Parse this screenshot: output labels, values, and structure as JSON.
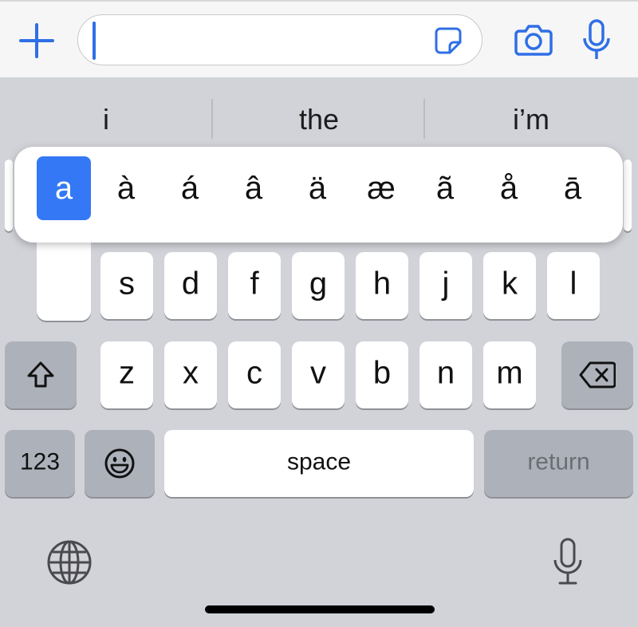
{
  "top_bar": {
    "input_value": "",
    "icons": [
      "plus-icon",
      "sticker-icon",
      "camera-icon",
      "microphone-icon"
    ]
  },
  "suggestions": [
    "i",
    "the",
    "i’m"
  ],
  "accent_popup": [
    "a",
    "à",
    "á",
    "â",
    "ä",
    "æ",
    "ã",
    "å",
    "ā"
  ],
  "row2": [
    "s",
    "d",
    "f",
    "g",
    "h",
    "j",
    "k",
    "l"
  ],
  "row3": [
    "z",
    "x",
    "c",
    "v",
    "b",
    "n",
    "m"
  ],
  "bottom": {
    "numbers_label": "123",
    "space_label": "space",
    "return_label": "return"
  },
  "colors": {
    "accent_blue": "#3478f6",
    "keyboard_bg": "#d1d3d9",
    "dark_key": "#adb1ba"
  }
}
